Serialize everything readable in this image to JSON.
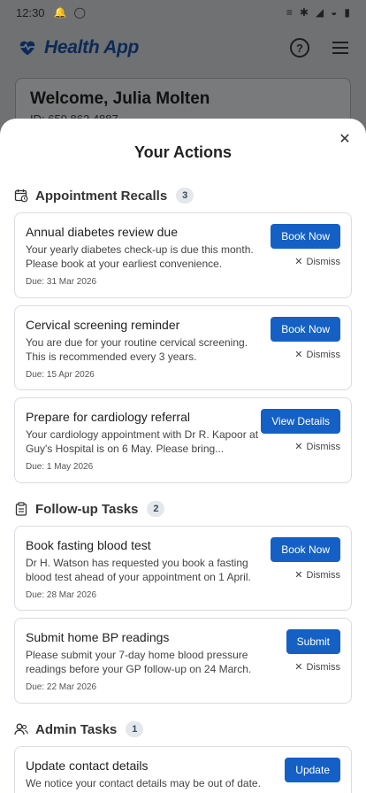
{
  "status_bar": {
    "time": "12:30"
  },
  "app_header": {
    "logo_text": "Health App"
  },
  "welcome": {
    "title": "Welcome, Julia Molten",
    "id_text": "ID: 650 862 4887"
  },
  "modal": {
    "title": "Your Actions",
    "sections": [
      {
        "title": "Appointment Recalls",
        "count": "3",
        "cards": [
          {
            "title": "Annual diabetes review due",
            "desc": "Your yearly diabetes check-up is due this month. Please book at your earliest convenience.",
            "due": "Due: 31 Mar 2026",
            "action": "Book Now",
            "dismiss": "Dismiss"
          },
          {
            "title": "Cervical screening reminder",
            "desc": "You are due for your routine cervical screening. This is recommended every 3 years.",
            "due": "Due: 15 Apr 2026",
            "action": "Book Now",
            "dismiss": "Dismiss"
          },
          {
            "title": "Prepare for cardiology referral",
            "desc": "Your cardiology appointment with Dr R. Kapoor at Guy's Hospital is on 6 May. Please bring...",
            "due": "Due: 1 May 2026",
            "action": "View Details",
            "dismiss": "Dismiss"
          }
        ]
      },
      {
        "title": "Follow-up Tasks",
        "count": "2",
        "cards": [
          {
            "title": "Book fasting blood test",
            "desc": "Dr H. Watson has requested you book a fasting blood test ahead of your appointment on 1 April.",
            "due": "Due: 28 Mar 2026",
            "action": "Book Now",
            "dismiss": "Dismiss"
          },
          {
            "title": "Submit home BP readings",
            "desc": "Please submit your 7-day home blood pressure readings before your GP follow-up on 24 March.",
            "due": "Due: 22 Mar 2026",
            "action": "Submit",
            "dismiss": "Dismiss"
          }
        ]
      },
      {
        "title": "Admin Tasks",
        "count": "1",
        "cards": [
          {
            "title": "Update contact details",
            "desc": "We notice your contact details may be out of date.",
            "due": "",
            "action": "Update",
            "dismiss": ""
          }
        ]
      }
    ]
  },
  "colors": {
    "primary": "#1560c4",
    "brand": "#0c2a55",
    "overlay": "#6f7173"
  },
  "icons": {
    "status": [
      "notification-bell-icon",
      "chat-bubble-icon",
      "vibrate-icon",
      "bluetooth-icon",
      "signal-icon",
      "wifi-icon",
      "battery-icon"
    ],
    "header": [
      "heart-pulse-logo-icon",
      "help-icon",
      "menu-icon"
    ],
    "sections": [
      "calendar-clock-icon",
      "clipboard-icon",
      "users-icon"
    ]
  }
}
